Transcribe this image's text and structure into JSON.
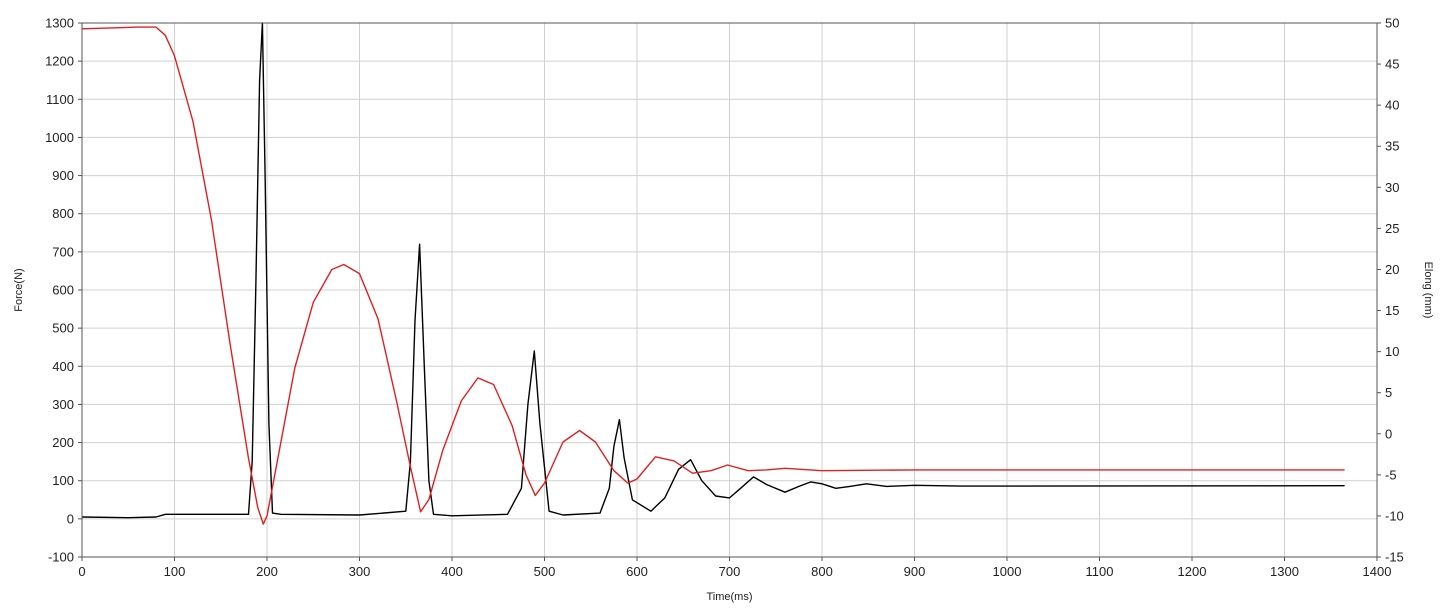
{
  "chart_data": {
    "type": "line",
    "xlabel": "Time(ms)",
    "ylabel": "Force(N)",
    "y2label": "Elong (mm)",
    "xlim": [
      0,
      1400
    ],
    "ylim": [
      -100,
      1300
    ],
    "y2lim": [
      -15,
      50
    ],
    "grid": true,
    "x_ticks": [
      0,
      100,
      200,
      300,
      400,
      500,
      600,
      700,
      800,
      900,
      1000,
      1100,
      1200,
      1300,
      1400
    ],
    "y_ticks": [
      -100,
      0,
      100,
      200,
      300,
      400,
      500,
      600,
      700,
      800,
      900,
      1000,
      1100,
      1200,
      1300
    ],
    "y2_ticks": [
      -15,
      -10,
      -5,
      0,
      5,
      10,
      15,
      20,
      25,
      30,
      35,
      40,
      45,
      50
    ],
    "colors": {
      "force": "#000000",
      "elong": "#e02020",
      "grid": "#d0d0d0",
      "frame": "#555555"
    },
    "series": [
      {
        "key": "force",
        "axis": "left",
        "x": [
          0,
          50,
          80,
          90,
          180,
          184,
          188,
          192,
          195,
          198,
          202,
          206,
          215,
          300,
          350,
          355,
          360,
          365,
          370,
          375,
          380,
          400,
          460,
          475,
          482,
          489,
          495,
          505,
          520,
          560,
          570,
          575,
          581,
          586,
          595,
          615,
          630,
          645,
          658,
          670,
          685,
          700,
          712,
          726,
          740,
          760,
          775,
          788,
          800,
          815,
          830,
          848,
          870,
          900,
          950,
          1365
        ],
        "values": [
          5,
          3,
          5,
          12,
          12,
          150,
          620,
          1150,
          1300,
          900,
          250,
          15,
          12,
          10,
          20,
          150,
          520,
          720,
          400,
          100,
          12,
          8,
          12,
          80,
          300,
          440,
          250,
          20,
          10,
          15,
          80,
          190,
          260,
          160,
          50,
          20,
          55,
          130,
          155,
          100,
          60,
          55,
          80,
          110,
          90,
          70,
          85,
          97,
          92,
          80,
          85,
          92,
          85,
          88,
          86,
          87
        ]
      },
      {
        "key": "elong",
        "axis": "right",
        "x": [
          0,
          60,
          80,
          90,
          100,
          120,
          140,
          160,
          180,
          190,
          196,
          200,
          210,
          230,
          250,
          270,
          283,
          300,
          320,
          340,
          355,
          366,
          375,
          390,
          410,
          428,
          445,
          465,
          480,
          490,
          500,
          520,
          538,
          555,
          575,
          590,
          600,
          620,
          640,
          660,
          680,
          698,
          720,
          740,
          760,
          800,
          900,
          1365
        ],
        "values": [
          49.3,
          49.5,
          49.5,
          48.5,
          46,
          38,
          26,
          11,
          -3,
          -9,
          -11,
          -10,
          -4,
          8,
          16,
          20,
          20.6,
          19.5,
          14,
          4,
          -4,
          -9.5,
          -8,
          -2,
          4,
          6.8,
          6,
          1,
          -5,
          -7.5,
          -6,
          -1,
          0.4,
          -1,
          -4.5,
          -6,
          -5.5,
          -2.8,
          -3.3,
          -4.8,
          -4.5,
          -3.8,
          -4.5,
          -4.4,
          -4.2,
          -4.5,
          -4.4,
          -4.4
        ]
      }
    ]
  }
}
